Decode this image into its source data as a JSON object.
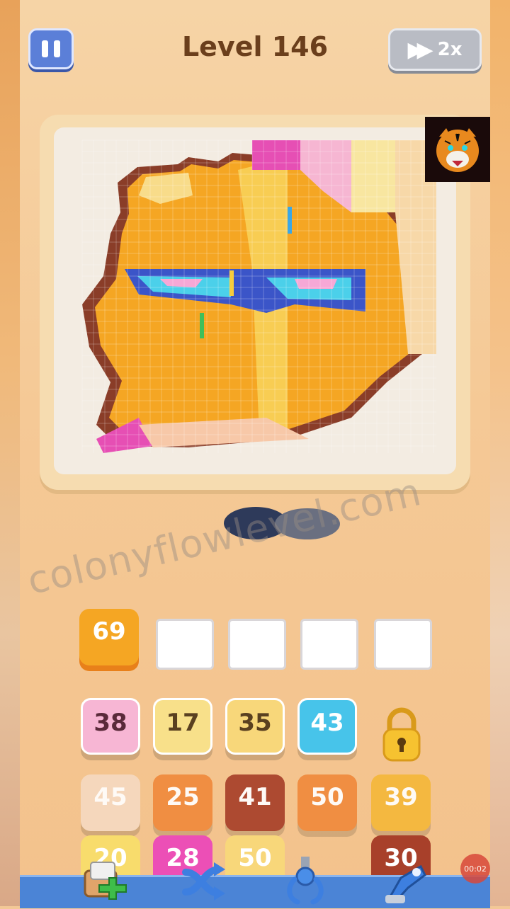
{
  "header": {
    "level_label": "Level 146",
    "speed_label": "2x"
  },
  "watermark": "colonyflowlevel.com",
  "slots": {
    "filled": [
      {
        "value": "69",
        "color": "#f5a623"
      }
    ],
    "empty_count": 4
  },
  "rows": [
    [
      {
        "value": "38",
        "color": "#f7b6d4",
        "text_color": "#5a2a3a"
      },
      {
        "value": "17",
        "color": "#f8e08a",
        "text_color": "#5a4020"
      },
      {
        "value": "35",
        "color": "#f8d77a",
        "text_color": "#5a4020"
      },
      {
        "value": "43",
        "color": "#47c4ea",
        "text_color": "#ffffff"
      }
    ],
    [
      {
        "value": "45",
        "color": "#f6d9c0",
        "text_color": "#ffffff"
      },
      {
        "value": "25",
        "color": "#f08a3c",
        "text_color": "#ffffff"
      },
      {
        "value": "41",
        "color": "#a8402a",
        "text_color": "#ffffff"
      },
      {
        "value": "50",
        "color": "#f08a3c",
        "text_color": "#ffffff"
      },
      {
        "value": "39",
        "color": "#f5b83a",
        "text_color": "#ffffff"
      }
    ],
    [
      {
        "value": "20",
        "color": "#f8dc6c",
        "text_color": "#ffffff"
      },
      {
        "value": "28",
        "color": "#ec4fb6",
        "text_color": "#ffffff"
      },
      {
        "value": "50",
        "color": "#f8d77a",
        "text_color": "#ffffff"
      },
      {
        "value": "30",
        "color": "#a8402a",
        "text_color": "#ffffff"
      }
    ]
  ],
  "tools": [
    "add-box-icon",
    "shuffle-icon",
    "claw-icon",
    "vacuum-icon"
  ],
  "timer": "00:02",
  "colors": {
    "accent": "#5b7fd8",
    "title": "#6b3f1c"
  }
}
